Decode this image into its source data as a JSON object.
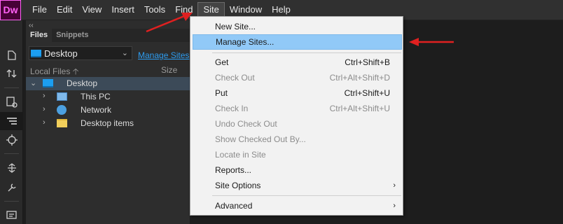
{
  "app": {
    "logo": "Dw"
  },
  "menubar": [
    "File",
    "Edit",
    "View",
    "Insert",
    "Tools",
    "Find",
    "Site",
    "Window",
    "Help"
  ],
  "files_panel": {
    "collapse": "‹‹",
    "tabs": [
      "Files",
      "Snippets"
    ],
    "site_select": "Desktop",
    "manage_link": "Manage Sites",
    "col_local": "Local Files",
    "col_sort": "🡡",
    "col_size": "Size",
    "tree": [
      {
        "label": "Desktop",
        "icon": "monitor-icon",
        "expand": "⌄",
        "selected": true
      },
      {
        "label": "This PC",
        "icon": "computer-icon",
        "expand": "›"
      },
      {
        "label": "Network",
        "icon": "network-icon",
        "expand": "›"
      },
      {
        "label": "Desktop items",
        "icon": "folder-icon",
        "expand": "›"
      }
    ]
  },
  "site_menu": {
    "items": [
      {
        "label": "New Site...",
        "shortcut": ""
      },
      {
        "label": "Manage Sites...",
        "shortcut": ""
      },
      {
        "label": "Get",
        "shortcut": "Ctrl+Shift+B"
      },
      {
        "label": "Check Out",
        "shortcut": "Ctrl+Alt+Shift+D"
      },
      {
        "label": "Put",
        "shortcut": "Ctrl+Shift+U"
      },
      {
        "label": "Check In",
        "shortcut": "Ctrl+Alt+Shift+U"
      },
      {
        "label": "Undo Check Out",
        "shortcut": ""
      },
      {
        "label": "Show Checked Out By...",
        "shortcut": ""
      },
      {
        "label": "Locate in Site",
        "shortcut": ""
      },
      {
        "label": "Reports...",
        "shortcut": ""
      },
      {
        "label": "Site Options",
        "submenu": "›"
      },
      {
        "label": "Advanced",
        "submenu": "›"
      }
    ]
  },
  "colors": {
    "accent": "#91c9f7",
    "annotation_arrow": "#e02020",
    "logo_bg": "#470137",
    "logo_fg": "#ff61f6"
  }
}
